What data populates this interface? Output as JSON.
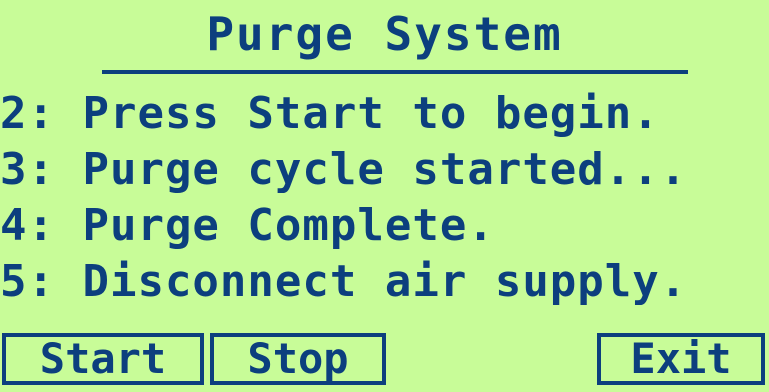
{
  "screen": {
    "title": "Purge System",
    "lines": [
      "2: Press Start to begin.",
      "3: Purge cycle started...",
      "4: Purge Complete.",
      "5: Disconnect air supply."
    ]
  },
  "buttons": {
    "start_label": "Start",
    "stop_label": "Stop",
    "exit_label": "Exit"
  },
  "colors": {
    "background": "#c8fc98",
    "foreground": "#0c3f7e"
  }
}
